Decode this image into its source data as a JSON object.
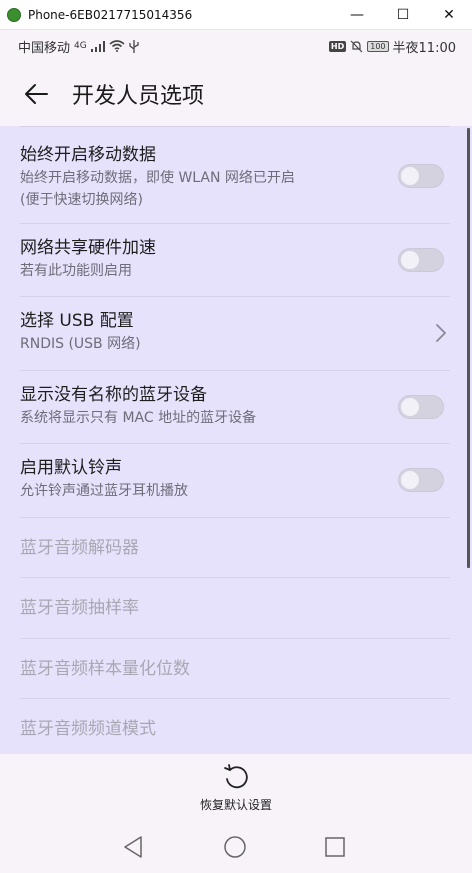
{
  "window": {
    "title": "Phone-6EB0217715014356",
    "minimize": "—",
    "maximize": "☐",
    "close": "✕"
  },
  "statusbar": {
    "carrier": "中国移动",
    "network": "4G",
    "signal_icon": "signal-icon",
    "wifi_icon": "wifi-icon",
    "usb_icon": "usb-icon",
    "hd": "HD",
    "mute_icon": "mute-icon",
    "battery": "100",
    "time": "半夜11:00"
  },
  "appbar": {
    "back_icon": "back-arrow-icon",
    "title": "开发人员选项"
  },
  "settings": [
    {
      "title": "始终开启移动数据",
      "subtitle_line1": "始终开启移动数据，即使 WLAN 网络已开启",
      "subtitle_line2": "(便于快速切换网络)",
      "control": "toggle",
      "checked": false
    },
    {
      "title": "网络共享硬件加速",
      "subtitle": "若有此功能则启用",
      "control": "toggle",
      "checked": false
    },
    {
      "title": "选择 USB 配置",
      "subtitle": "RNDIS (USB 网络)",
      "control": "chevron"
    },
    {
      "title": "显示没有名称的蓝牙设备",
      "subtitle": "系统将显示只有 MAC 地址的蓝牙设备",
      "control": "toggle",
      "checked": false
    },
    {
      "title": "启用默认铃声",
      "subtitle": "允许铃声通过蓝牙耳机播放",
      "control": "toggle",
      "checked": false
    },
    {
      "title": "蓝牙音频解码器",
      "enabled": false
    },
    {
      "title": "蓝牙音频抽样率",
      "enabled": false
    },
    {
      "title": "蓝牙音频样本量化位数",
      "enabled": false
    },
    {
      "title": "蓝牙音频频道模式",
      "enabled": false
    }
  ],
  "bottom": {
    "reset_icon": "reset-icon",
    "reset_label": "恢复默认设置"
  },
  "navbar": {
    "back": "nav-back-icon",
    "home": "nav-home-icon",
    "recents": "nav-recents-icon"
  },
  "colors": {
    "list_bg": "#e6e2fb",
    "page_bg": "#f7f3f9",
    "toggle_off": "#d5d2e0",
    "disabled_text": "#a9a7b3"
  }
}
